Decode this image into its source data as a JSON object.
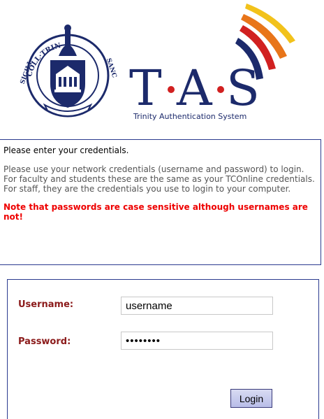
{
  "header": {
    "seal": {
      "icon": "college-seal-icon",
      "text_left": "SIGILL",
      "text_top": "COLL·TRIN",
      "text_right": "SANC",
      "colors": {
        "navy": "#1c2a6b",
        "gold": "#c9a227"
      }
    },
    "tas_logo": {
      "letters": "T·A·S",
      "letter_T": "T",
      "letter_A": "A",
      "letter_S": "S",
      "subtitle": "Trinity Authentication System",
      "colors": {
        "navy": "#1c2a6b",
        "red": "#d12020",
        "orange": "#e8751a",
        "yellow": "#f2c21b"
      }
    }
  },
  "message": {
    "prompt": "Please enter your credentials.",
    "info": "Please use your network credentials (username and password) to login. For faculty and students these are the same as your TCOnline credentials. For staff, they are the credentials you use to login to your computer.",
    "warning": "Note that passwords are case sensitive although usernames are not!"
  },
  "form": {
    "username_label": "Username:",
    "username_value": "username",
    "password_label": "Password:",
    "password_value": "••••••••",
    "login_label": "Login"
  }
}
